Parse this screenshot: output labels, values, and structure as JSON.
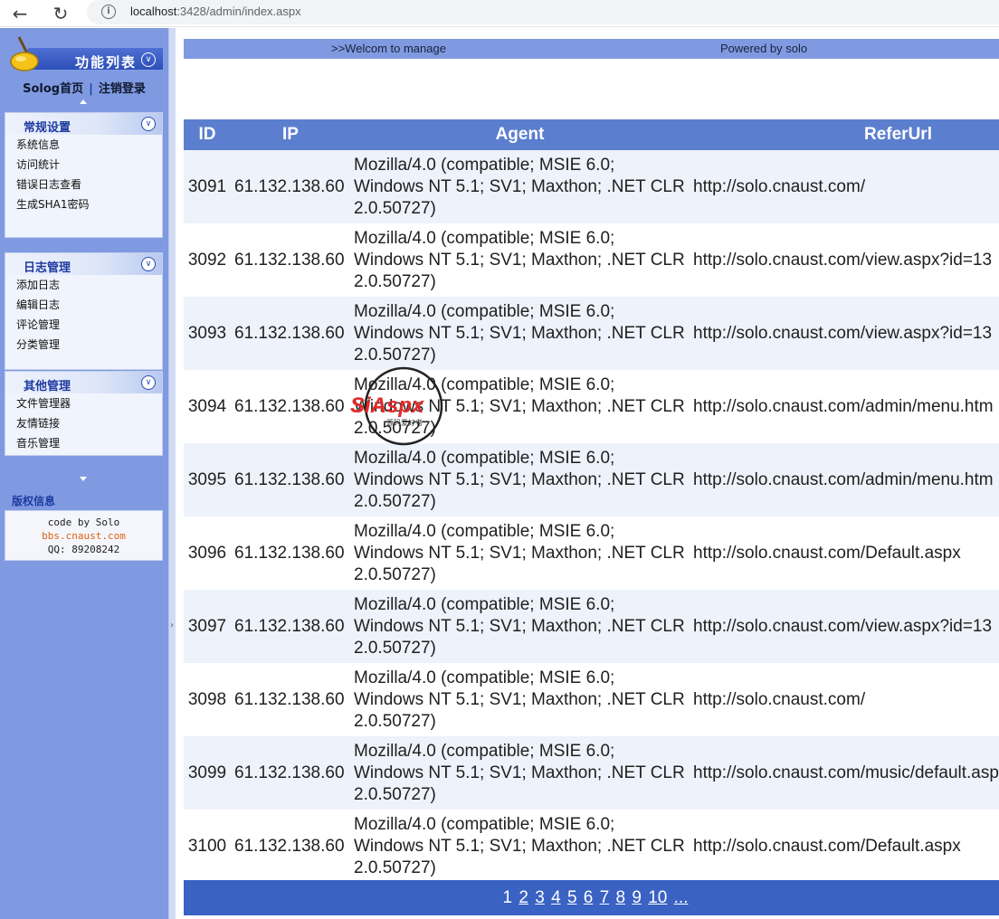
{
  "browser": {
    "url_host": "localhost",
    "url_rest": ":3428/admin/index.aspx"
  },
  "sidebar": {
    "logo_title": "功能列表",
    "links": [
      "Solog首页",
      "注销登录"
    ],
    "menus": [
      {
        "title": "常规设置",
        "items": [
          "系统信息",
          "访问统计",
          "错误日志查看",
          "生成SHA1密码"
        ]
      },
      {
        "title": "日志管理",
        "items": [
          "添加日志",
          "编辑日志",
          "评论管理",
          "分类管理"
        ]
      },
      {
        "title": "其他管理",
        "items": [
          "文件管理器",
          "友情链接",
          "音乐管理"
        ]
      }
    ],
    "copyright": {
      "title": "版权信息",
      "line1": "code by Solo",
      "line2": "bbs.cnaust.com",
      "line3": "QQ: 89208242"
    }
  },
  "header": {
    "welcome": ">>Welcom to manage",
    "powered": "Powered by solo"
  },
  "table": {
    "columns": [
      "ID",
      "IP",
      "Agent",
      "ReferUrl"
    ],
    "rows": [
      {
        "id": "3091",
        "ip": "61.132.138.60",
        "agent": "Mozilla/4.0 (compatible; MSIE 6.0; Windows NT 5.1; SV1; Maxthon; .NET CLR 2.0.50727)",
        "url": "http://solo.cnaust.com/"
      },
      {
        "id": "3092",
        "ip": "61.132.138.60",
        "agent": "Mozilla/4.0 (compatible; MSIE 6.0; Windows NT 5.1; SV1; Maxthon; .NET CLR 2.0.50727)",
        "url": "http://solo.cnaust.com/view.aspx?id=13"
      },
      {
        "id": "3093",
        "ip": "61.132.138.60",
        "agent": "Mozilla/4.0 (compatible; MSIE 6.0; Windows NT 5.1; SV1; Maxthon; .NET CLR 2.0.50727)",
        "url": "http://solo.cnaust.com/view.aspx?id=13"
      },
      {
        "id": "3094",
        "ip": "61.132.138.60",
        "agent": "Mozilla/4.0 (compatible; MSIE 6.0; Windows NT 5.1; SV1; Maxthon; .NET CLR 2.0.50727)",
        "url": "http://solo.cnaust.com/admin/menu.htm"
      },
      {
        "id": "3095",
        "ip": "61.132.138.60",
        "agent": "Mozilla/4.0 (compatible; MSIE 6.0; Windows NT 5.1; SV1; Maxthon; .NET CLR 2.0.50727)",
        "url": "http://solo.cnaust.com/admin/menu.htm"
      },
      {
        "id": "3096",
        "ip": "61.132.138.60",
        "agent": "Mozilla/4.0 (compatible; MSIE 6.0; Windows NT 5.1; SV1; Maxthon; .NET CLR 2.0.50727)",
        "url": "http://solo.cnaust.com/Default.aspx"
      },
      {
        "id": "3097",
        "ip": "61.132.138.60",
        "agent": "Mozilla/4.0 (compatible; MSIE 6.0; Windows NT 5.1; SV1; Maxthon; .NET CLR 2.0.50727)",
        "url": "http://solo.cnaust.com/view.aspx?id=13"
      },
      {
        "id": "3098",
        "ip": "61.132.138.60",
        "agent": "Mozilla/4.0 (compatible; MSIE 6.0; Windows NT 5.1; SV1; Maxthon; .NET CLR 2.0.50727)",
        "url": "http://solo.cnaust.com/"
      },
      {
        "id": "3099",
        "ip": "61.132.138.60",
        "agent": "Mozilla/4.0 (compatible; MSIE 6.0; Windows NT 5.1; SV1; Maxthon; .NET CLR 2.0.50727)",
        "url": "http://solo.cnaust.com/music/default.aspx"
      },
      {
        "id": "3100",
        "ip": "61.132.138.60",
        "agent": "Mozilla/4.0 (compatible; MSIE 6.0; Windows NT 5.1; SV1; Maxthon; .NET CLR 2.0.50727)",
        "url": "http://solo.cnaust.com/Default.aspx"
      }
    ]
  },
  "pager": {
    "current": "1",
    "pages": [
      "2",
      "3",
      "4",
      "5",
      "6",
      "7",
      "8",
      "9",
      "10"
    ],
    "more": "..."
  },
  "watermark": {
    "text": "SiAspx",
    "subtext": "源码爱好者"
  },
  "colors": {
    "sidebar_bg": "#7f9ae0",
    "header_bg": "#5b7fce",
    "pager_bg": "#3a62c3",
    "row_alt": "#eef2fa"
  }
}
